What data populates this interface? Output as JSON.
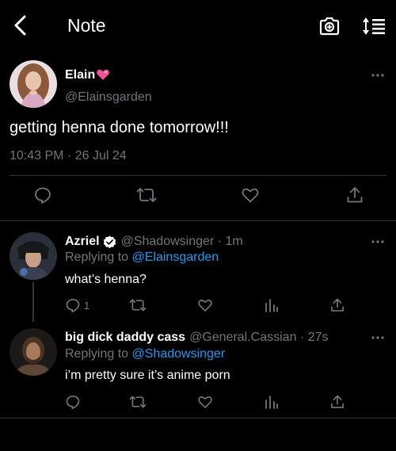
{
  "header": {
    "title": "Note",
    "icons": [
      "back-arrow-icon",
      "camera-icon",
      "sort-icon"
    ]
  },
  "main_post": {
    "name": "Elain",
    "name_emoji_icon": "pink-heart-icon",
    "handle": "@Elainsgarden",
    "text": "getting henna done tomorrow!!!",
    "timestamp": "10:43 PM · 26 Jul 24",
    "actions": [
      "reply-icon",
      "repost-icon",
      "like-icon",
      "share-icon"
    ]
  },
  "replies": [
    {
      "name": "Azriel",
      "verified": true,
      "handle_time": "@Shadowsinger · 1m",
      "replying_prefix": "Replying to ",
      "replying_to": "@Elainsgarden",
      "text": "what’s henna?",
      "reply_count": "1"
    },
    {
      "name": "big dick daddy cass",
      "verified": false,
      "handle_time": "@General.Cassian · 27s",
      "replying_prefix": "Replying to ",
      "replying_to": "@Shadowsinger",
      "text": "i’m pretty sure it’s anime porn",
      "reply_count": ""
    }
  ],
  "colors": {
    "background": "#000000",
    "text": "#ffffff",
    "secondary": "#71767b",
    "link": "#1d9bf0",
    "verified": "#ffffff",
    "divider": "#2f3336"
  }
}
